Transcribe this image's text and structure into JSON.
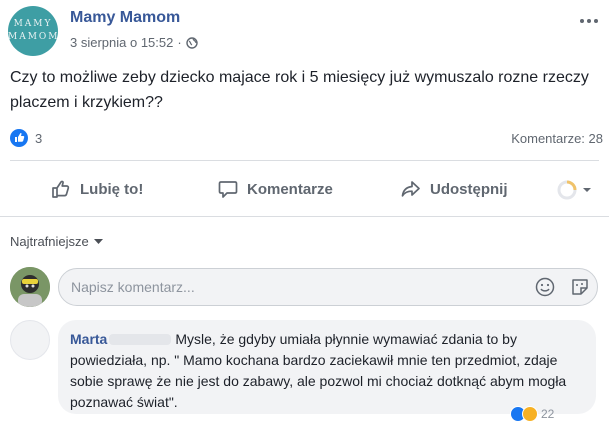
{
  "post": {
    "page_name": "Mamy Mamom",
    "avatar_line1": "MAMY",
    "avatar_line2": "MAMOM",
    "date": "3 sierpnia o 15:52",
    "separator": "·",
    "privacy_icon": "globe-icon",
    "more_icon": "more-dots-icon",
    "text": "Czy to możliwe zeby dziecko majace rok i 5 miesięcy już wymuszalo rozne rzeczy placzem i krzykiem??"
  },
  "reactions": {
    "icon": "like-icon",
    "count": "3",
    "comments_label": "Komentarze: 28"
  },
  "actions": {
    "like_label": "Lubię to!",
    "comment_label": "Komentarze",
    "share_label": "Udostępnij"
  },
  "sort": {
    "label": "Najtrafniejsze"
  },
  "composer": {
    "placeholder": "Napisz komentarz..."
  },
  "comments": [
    {
      "author": "Marta",
      "text": "Mysle, że gdyby umiała płynnie wymawiać zdania to by powiedziała, np. \" Mamo kochana bardzo zaciekawił mnie ten przedmiot, zdaje sobie sprawę że nie jest do zabawy, ale pozwol mi chociaż dotknąć abym mogła poznawać świat\".",
      "reaction_count": "22"
    }
  ],
  "colors": {
    "accent": "#385898",
    "like_blue": "#1877f2",
    "muted_text": "#606770"
  }
}
